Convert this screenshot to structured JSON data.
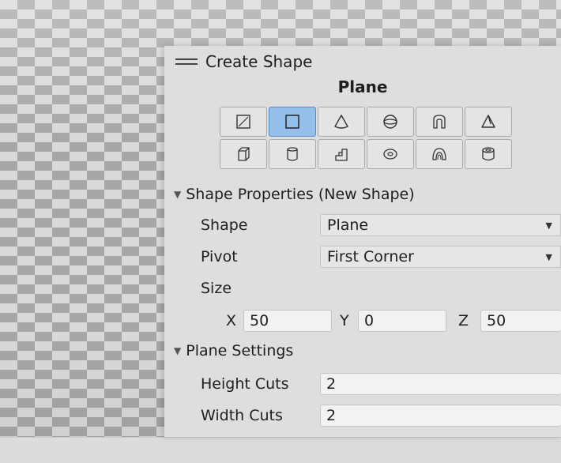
{
  "panel": {
    "title": "Create Shape",
    "shape_name": "Plane"
  },
  "shape_buttons": {
    "row1": [
      "sprite-icon",
      "plane-icon",
      "cone-icon",
      "sphere-icon",
      "arch-icon",
      "prism-icon"
    ],
    "row2": [
      "cube-icon",
      "cylinder-icon",
      "stairs-icon",
      "torus-icon",
      "curved-stairs-icon",
      "pipe-icon"
    ],
    "selected": "plane-icon"
  },
  "shape_properties": {
    "header": "Shape Properties (New Shape)",
    "shape_label": "Shape",
    "shape_value": "Plane",
    "pivot_label": "Pivot",
    "pivot_value": "First Corner",
    "size_label": "Size",
    "x_label": "X",
    "x_value": "50",
    "y_label": "Y",
    "y_value": "0",
    "z_label": "Z",
    "z_value": "50"
  },
  "plane_settings": {
    "header": "Plane Settings",
    "height_cuts_label": "Height Cuts",
    "height_cuts_value": "2",
    "width_cuts_label": "Width Cuts",
    "width_cuts_value": "2"
  },
  "colors": {
    "selected_button": "#96c0ec",
    "panel_bg": "#dedede"
  }
}
